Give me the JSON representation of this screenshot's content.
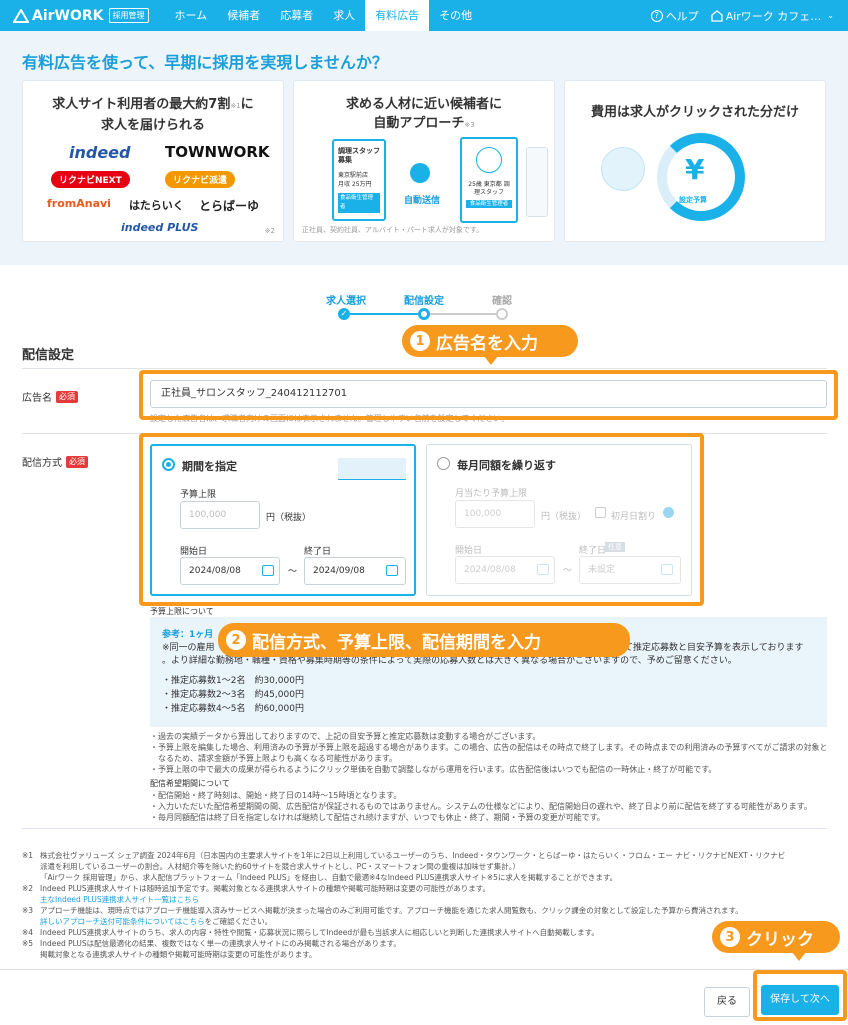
{
  "header": {
    "brand": "AirWORK",
    "badge": "採用管理",
    "nav": [
      "ホーム",
      "候補者",
      "応募者",
      "求人",
      "有料広告",
      "その他"
    ],
    "help": "ヘルプ",
    "account": "Airワーク カフェ…"
  },
  "hero": {
    "title": "有料広告を使って、早期に採用を実現しませんか？",
    "card1": {
      "title_line1": "求人サイト利用者の最大約7割",
      "title_mark": "※1",
      "title_line1b": "に",
      "title_line2": "求人を届けられる",
      "brands": [
        "indeed",
        "TOWNWORK",
        "リクナビNEXT",
        "リクナビ派遣",
        "fromAnavi",
        "はたらいく",
        "とらばーゆ",
        "indeed PLUS"
      ],
      "note": "※2"
    },
    "card2": {
      "title_line1": "求める人材に近い候補者に",
      "title_line2": "自動アプローチ",
      "title_mark": "※3",
      "job_title": "調理スタッフ募集",
      "job_place": "東京駅前店",
      "job_pay": "月収 25万円",
      "job_tag": "食品衛生管理者",
      "send_label": "自動送信",
      "cand_info": "25歳 東京都 調理スタッフ",
      "cand_tag": "食品衛生管理者",
      "note": "正社員、契約社員、アルバイト・パート求人が対象です。"
    },
    "card3": {
      "title": "費用は求人がクリックされた分だけ",
      "yen": "¥",
      "budget_label": "設定予算"
    }
  },
  "progress": {
    "steps": [
      "求人選択",
      "配信設定",
      "確認"
    ]
  },
  "section": {
    "title": "配信設定"
  },
  "ad_name": {
    "label": "広告名",
    "required": "必須",
    "value": "正社員_サロンスタッフ_240412112701",
    "hint": "設定した広告名は、求職者向けの画面には表示されません。管理しやすい名前を設定してください。"
  },
  "delivery": {
    "label": "配信方式",
    "required": "必須",
    "option1": {
      "title": "期間を指定",
      "budget_label": "予算上限",
      "budget_placeholder": "100,000",
      "budget_unit": "円（税抜）",
      "start_label": "開始日",
      "start_value": "2024/08/08",
      "end_label": "終了日",
      "end_value": "2024/09/08",
      "tilde": "〜"
    },
    "option2": {
      "title": "毎月同額を繰り返す",
      "budget_label": "月当たり予算上限",
      "budget_placeholder": "100,000",
      "budget_unit": "円（税抜）",
      "first_month": "初月日割り",
      "start_label": "開始日",
      "start_value": "2024/08/08",
      "end_label": "終了日",
      "end_tag": "任意",
      "end_placeholder": "未設定",
      "tilde": "〜"
    }
  },
  "budget_info": {
    "heading": "予算上限について",
    "ref": "参考：1ヶ月",
    "text1": "※同一の雇用",
    "text1b": "て推定応募数と目安予算を表示しております",
    "text2": "。より詳細な勤務地・職種・資格や募集時期等の条件によって実際の応募人数とは大きく異なる場合がございますので、予めご留意ください。",
    "rows": [
      "・推定応募数1〜2名　約30,000円",
      "・推定応募数2〜3名　約45,000円",
      "・推定応募数4〜5名　約60,000円"
    ],
    "bullets": [
      "・過去の実績データから算出しておりますので、上記の目安予算と推定応募数は変動する場合がございます。",
      "・予算上限を編集した場合、利用済みの予算が予算上限を超過する場合があります。この場合、広告の配信はその時点で終了します。その時点までの利用済みの予算すべてがご請求の対象と",
      "　なるため、請求金額が予算上限よりも高くなる可能性があります。",
      "・予算上限の中で最大の成果が得られるようにクリック単価を自動で調整しながら運用を行います。広告配信後はいつでも配信の一時休止・終了が可能です。"
    ]
  },
  "period_info": {
    "heading": "配信希望期間について",
    "bullets": [
      "・配信開始・終了時刻は、開始・終了日の14時〜15時頃となります。",
      "・入力いただいた配信希望期間の間、広告配信が保証されるものではありません。システムの仕様などにより、配信開始日の遅れや、終了日より前に配信を終了する可能性があります。",
      "・毎月同額配信は終了日を指定しなければ継続して配信され続けますが、いつでも休止・終了、期間・予算の変更が可能です。"
    ]
  },
  "footnotes": [
    {
      "mark": "※1",
      "lines": [
        "株式会社ヴァリューズ シェア調査 2024年6月（日本国内の主要求人サイトを1年に2日以上利用しているユーザーのうち、Indeed・タウンワーク・とらばーゆ・はたらいく・フロム・エー ナビ・リクナビNEXT・リクナビ",
        "派遣を利用しているユーザーの割合。人材紹介等を除いた約60サイトを競合求人サイトとし、PC・スマートフォン間の重複は加味せず集計。）",
        "「Airワーク 採用管理」から、求人配信プラットフォーム「Indeed PLUS」を経由し、自動で最適※4なIndeed PLUS連携求人サイト※5に求人を掲載することができます。"
      ],
      "link": ""
    },
    {
      "mark": "※2",
      "lines": [
        "Indeed PLUS連携求人サイトは随時追加予定です。掲載対象となる連携求人サイトの種類や掲載可能時期は変更の可能性があります。"
      ],
      "link": "主なIndeed PLUS連携求人サイト一覧はこちら"
    },
    {
      "mark": "※3",
      "lines": [
        "アプローチ機能は、現時点ではアプローチ機能導入済みサービスへ掲載が決まった場合のみご利用可能です。アプローチ機能を通じた求人閲覧数も、クリック課金の対象として設定した予算から費消されます。"
      ],
      "link": "詳しいアプローチ送付可能条件についてはこちら",
      "link_suffix": "をご確認ください。"
    },
    {
      "mark": "※4",
      "lines": [
        "Indeed PLUS連携求人サイトのうち、求人の内容・特性や閲覧・応募状況に照らしてIndeedが最も当該求人に相応しいと判断した連携求人サイトへ自動掲載します。"
      ],
      "link": ""
    },
    {
      "mark": "※5",
      "lines": [
        "Indeed PLUSは配信最適化の結果、複数ではなく単一の連携求人サイトにのみ掲載される場合があります。",
        "掲載対象となる連携求人サイトの種類や掲載可能時期は変更の可能性があります。"
      ],
      "link": ""
    }
  ],
  "callouts": {
    "c1": {
      "num": "1",
      "text": "広告名を入力"
    },
    "c2": {
      "num": "2",
      "text": "配信方式、予算上限、配信期間を入力"
    },
    "c3": {
      "num": "3",
      "text": "クリック"
    }
  },
  "buttons": {
    "back": "戻る",
    "save": "保存して次へ"
  },
  "colors": {
    "primary": "#1ab0e8",
    "accent": "#f7991c",
    "required": "#e23b3b"
  }
}
